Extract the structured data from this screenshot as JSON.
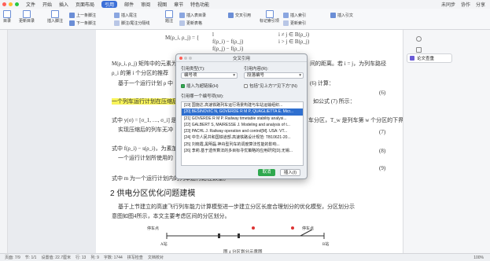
{
  "titlebar": {
    "menus": [
      "文件",
      "开始",
      "插入",
      "页面布局",
      "引用",
      "邮件",
      "审阅",
      "视图",
      "章节",
      "特色功能"
    ],
    "active_menu": "引用",
    "right": [
      "未同步",
      "协作",
      "分享"
    ]
  },
  "ribbon": {
    "toc": "目录",
    "update_toc": "更新目录",
    "insert_footnote": "插入脚注",
    "prev_footnote": "上一条脚注",
    "next_footnote": "下一条脚注",
    "insert_endnote": "插入尾注",
    "footnote_endnote_sep": "脚注/尾注分隔线",
    "caption": "题注",
    "insert_caption": "插入表目录",
    "cross_ref": "交叉引用",
    "update_table": "更新表格",
    "mark_index": "标记索引项",
    "insert_index": "插入索引",
    "insert_citation": "插入引文",
    "update_index": "更新索引"
  },
  "rightpanel": {
    "paper_check": "论文查重"
  },
  "document": {
    "eq_top_left": "M(ρ_i, ρ_j) = {",
    "eq_top_rows": [
      "l",
      "f(ρ_i) − f(ρ_j)",
      "f(ρ_j) − f(ρ_i)"
    ],
    "eq_top_conds": [
      "i ≠ j ∈ B(ρ_i)",
      "i > j ∈ B(ρ_j)",
      ""
    ],
    "para1": "M(ρ_i, ρ_j) 矩阵中的元素为",
    "para1_right": "间的距离。若 i = j，为列车路径",
    "para2": "ρ_i 的第 i 个分区的推荐",
    "para3": "基于一个运行计划 ρ 中",
    "para3_right": "(6) 计算：",
    "highlight": "一个列车运行计划在压缩后",
    "highlight_right": "如公式 (7) 所示：",
    "eq_num_6": "(6)",
    "para4": "式中 y(σ) = [σ_1, …, σ_i] 是一个",
    "para4_right": "车分区，T_w 是列车第 w 个分区的下界。",
    "para5": "实现压缩后的列车无冲",
    "eq_num_7": "(7)",
    "eq_num_8": "(8)",
    "para6": "式中 f(ρ_i) − s(ρ_i)，为素加",
    "para6_right": "",
    "para7": "一个运行计划所使用的",
    "eq_num_9": "(9)",
    "para8": "式中 m 为一个运行计划内的列车运行路径数量。",
    "section_heading": "2  供电分区优化问题建模",
    "body1": "基于上节建立的高速飞行列车能力计算模型进一步建立分区长度合理划分的优化模型，分区划分示",
    "body2": "意图如图4所示，本文主要考虑区间的分区划分。",
    "fig_label_left": "停车点",
    "fig_label_right": "停车点",
    "fig_station_a": "A站",
    "fig_station_b": "B站",
    "fig_caption": "图 4  分区划分示意图"
  },
  "dialog": {
    "title": "交叉引用",
    "ref_type_label": "引用类型(T):",
    "ref_type_value": "编号项",
    "ref_content_label": "引用内容(R):",
    "ref_content_value": "段落编号",
    "insert_hyperlink_label": "插入为超链接(H)",
    "insert_hyperlink_checked": true,
    "above_below_label": "包括\"见上方\"/\"见下方\"(N)",
    "above_below_checked": false,
    "list_label": "引用哪一个编号项(W):",
    "items": [
      "[19] 国施达.高速铁路列车运行场景构建与车站运输组织...",
      "[20] BEŠINOVIĆ N, GOVERDE R M P, QUAGLIETTA E. Micr...",
      "[21] GOVERDE R M P. Railway timetable stability analysi...",
      "[22] GALBERT S, MAIRESSE J. Modeling and analysis of t...",
      "[23] PACHL J. Railway operation and control[M]. USA: VT...",
      "[24] 中华人民共和国铁道部.高速铁路设计规范: TB10621-20...",
      "[25] 刘晓霞,黑明磊.神舟型列车的调度算法性能的影响...",
      "[26] 李莉.基于遗传算法的多目标寻优策略的应用研究[D].无锡..."
    ],
    "selected_index": 1,
    "cancel": "取消",
    "insert": "插入(I)"
  },
  "statusbar": {
    "page": "页面: 7/9",
    "section": "节: 1/1",
    "settings": "设置值: 22.7厘米",
    "row": "行: 13",
    "col": "列: 9",
    "words": "字数: 1744",
    "spell": "拼写检查",
    "doc_check": "文档校对",
    "zoom": "100%"
  },
  "colors": {
    "accent": "#3b6fd8",
    "selected_item": "#2f6fcf",
    "highlight": "#f7f35a",
    "cancel_button": "#2fa84f",
    "window_bg": "#e9ebef"
  }
}
